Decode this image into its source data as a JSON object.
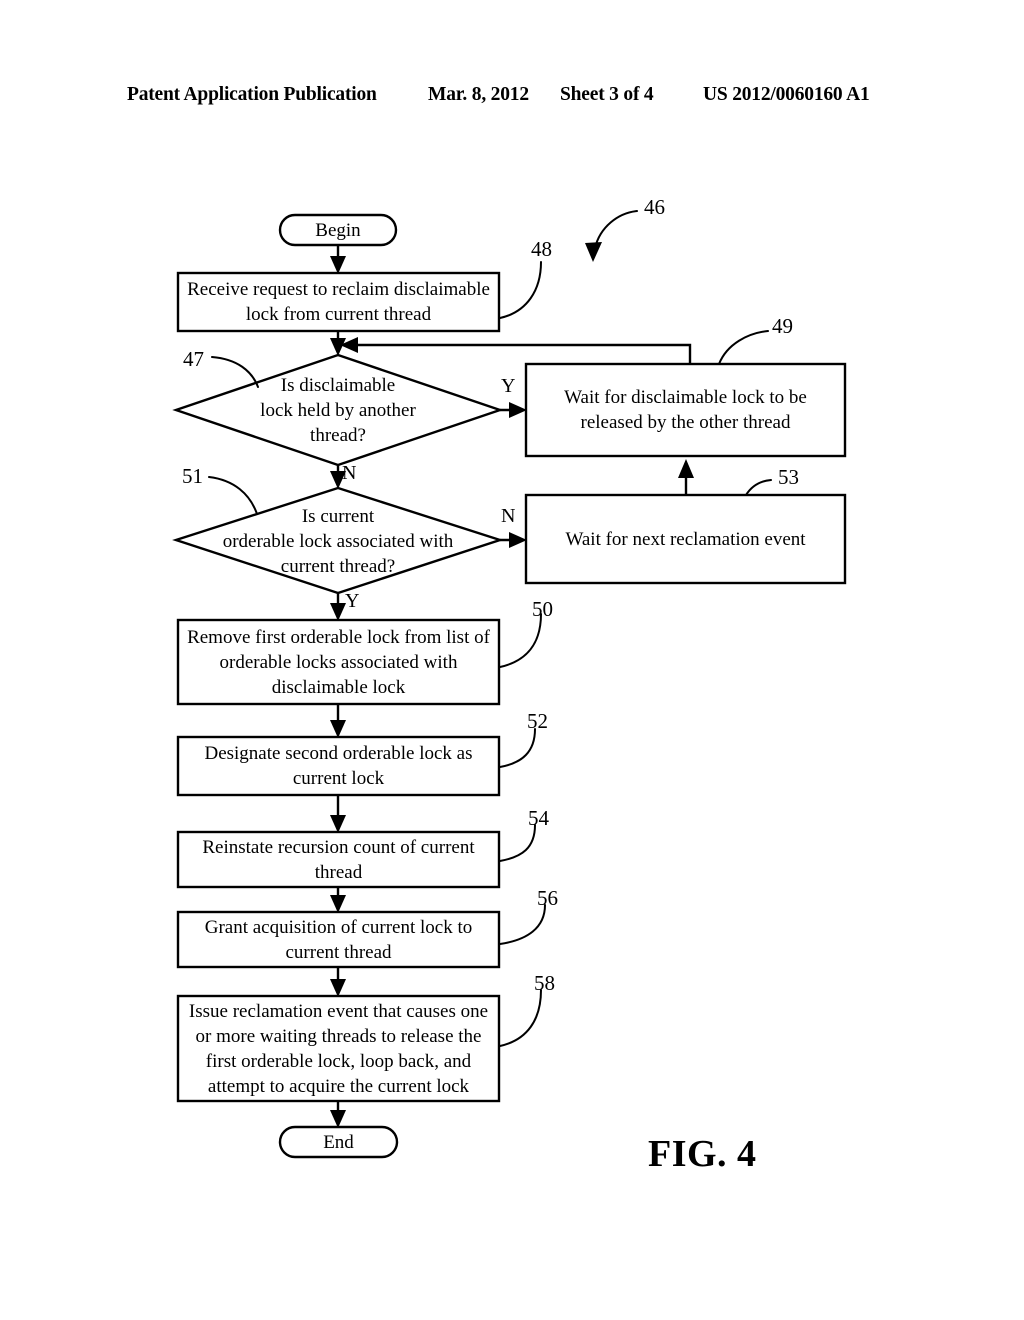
{
  "header": {
    "publication": "Patent Application Publication",
    "date": "Mar. 8, 2012",
    "sheet": "Sheet 3 of 4",
    "patent_number": "US 2012/0060160 A1"
  },
  "figure": {
    "label": "FIG. 4",
    "reference": "46",
    "nodes": {
      "begin": {
        "text": "Begin",
        "type": "terminal"
      },
      "end": {
        "text": "End",
        "type": "terminal"
      },
      "n48": {
        "ref": "48",
        "type": "process",
        "lines": [
          "Receive request to reclaim disclaimable",
          "lock from current thread"
        ]
      },
      "n47": {
        "ref": "47",
        "type": "decision",
        "lines": [
          "Is disclaimable",
          "lock held by another",
          "thread?"
        ]
      },
      "n49": {
        "ref": "49",
        "type": "process",
        "lines": [
          "Wait for disclaimable lock to be",
          "released by the other thread"
        ]
      },
      "n51": {
        "ref": "51",
        "type": "decision",
        "lines": [
          "Is current",
          "orderable lock associated with",
          "current thread?"
        ]
      },
      "n53": {
        "ref": "53",
        "type": "process",
        "lines": [
          "Wait for next reclamation event"
        ]
      },
      "n50": {
        "ref": "50",
        "type": "process",
        "lines": [
          "Remove first orderable lock from list of",
          "orderable locks associated with",
          "disclaimable lock"
        ]
      },
      "n52": {
        "ref": "52",
        "type": "process",
        "lines": [
          "Designate second orderable lock as",
          "current lock"
        ]
      },
      "n54": {
        "ref": "54",
        "type": "process",
        "lines": [
          "Reinstate recursion count of current",
          "thread"
        ]
      },
      "n56": {
        "ref": "56",
        "type": "process",
        "lines": [
          "Grant acquisition of current lock to",
          "current thread"
        ]
      },
      "n58": {
        "ref": "58",
        "type": "process",
        "lines": [
          "Issue reclamation event that causes one",
          "or more waiting threads to release the",
          "first orderable lock, loop back, and",
          "attempt to acquire the current lock"
        ]
      }
    },
    "branch_labels": {
      "d47_yes": "Y",
      "d47_no": "N",
      "d51_no": "N",
      "d51_yes": "Y"
    },
    "colors": {
      "ink": "#000000",
      "paper": "#ffffff"
    }
  }
}
